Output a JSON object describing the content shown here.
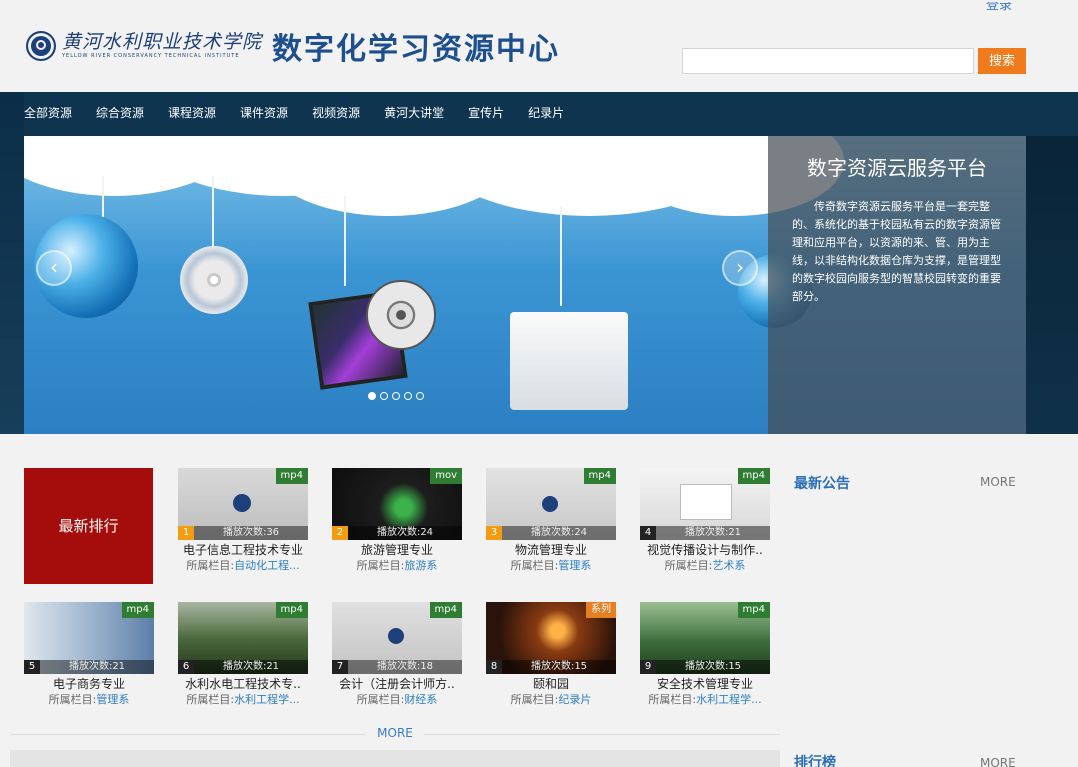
{
  "header": {
    "school_name": "黄河水利职业技术学院",
    "school_name_en": "YELLOW RIVER CONSERVANCY TECHNICAL INSTITUTE",
    "site_title": "数字化学习资源中心",
    "login_label": "登录",
    "search_placeholder": "",
    "search_button": "搜索"
  },
  "nav": {
    "items": [
      {
        "label": "全部资源"
      },
      {
        "label": "综合资源"
      },
      {
        "label": "课程资源"
      },
      {
        "label": "课件资源"
      },
      {
        "label": "视频资源"
      },
      {
        "label": "黄河大讲堂"
      },
      {
        "label": "宣传片"
      },
      {
        "label": "纪录片"
      }
    ]
  },
  "banner": {
    "title": "数字资源云服务平台",
    "description": "传奇数字资源云服务平台是一套完整的、系统化的基于校园私有云的数字资源管理和应用平台，以资源的来、管、用为主线，以非结构化数据仓库为支撑，是管理型的数字校园向服务型的智慧校园转变的重要部分。",
    "dots": 5,
    "active_dot": 1
  },
  "rank": {
    "label": "最新排行",
    "category_prefix": "所属栏目:",
    "items": [
      {
        "num": "1",
        "format": "mp4",
        "plays": "播放次数:36",
        "title": "电子信息工程技术专业",
        "category": "自动化工程..."
      },
      {
        "num": "2",
        "format": "mov",
        "plays": "播放次数:24",
        "title": "旅游管理专业",
        "category": "旅游系"
      },
      {
        "num": "3",
        "format": "mp4",
        "plays": "播放次数:24",
        "title": "物流管理专业",
        "category": "管理系"
      },
      {
        "num": "4",
        "format": "mp4",
        "plays": "播放次数:21",
        "title": "视觉传播设计与制作..",
        "category": "艺术系"
      },
      {
        "num": "5",
        "format": "mp4",
        "plays": "播放次数:21",
        "title": "电子商务专业",
        "category": "管理系"
      },
      {
        "num": "6",
        "format": "mp4",
        "plays": "播放次数:21",
        "title": "水利水电工程技术专..",
        "category": "水利工程学..."
      },
      {
        "num": "7",
        "format": "mp4",
        "plays": "播放次数:18",
        "title": "会计（注册会计师方..",
        "category": "财经系"
      },
      {
        "num": "8",
        "format": "系列",
        "plays": "播放次数:15",
        "title": "颐和园",
        "category": "纪录片"
      },
      {
        "num": "9",
        "format": "mp4",
        "plays": "播放次数:15",
        "title": "安全技术管理专业",
        "category": "水利工程学..."
      }
    ],
    "more": "MORE"
  },
  "sidebar": {
    "notice_title": "最新公告",
    "notice_more": "MORE",
    "ranking_title": "排行榜",
    "ranking_more": "MORE"
  },
  "colors": {
    "accent": "#f07b1c",
    "brand_blue": "#1d4f8e",
    "rank_red": "#a50d0d",
    "badge_green": "#2e7d32",
    "badge_orange": "#e67e22",
    "link_blue": "#2f7ec5"
  }
}
